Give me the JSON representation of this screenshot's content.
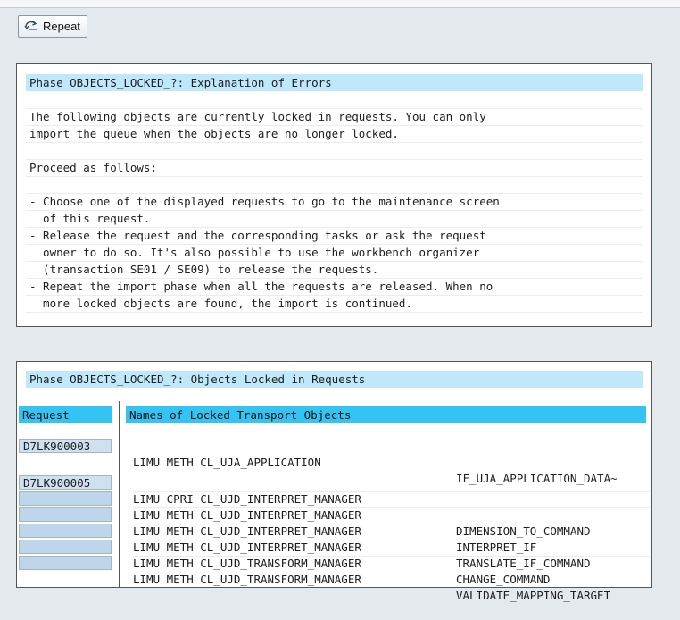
{
  "toolbar": {
    "repeat_label": "Repeat",
    "repeat_icon": "repeat-icon"
  },
  "explanation": {
    "title": "Phase OBJECTS_LOCKED_?: Explanation of Errors",
    "lines": [
      "",
      "The following objects are currently locked in requests. You can only",
      "import the queue when the objects are no longer locked.",
      "",
      "Proceed as follows:",
      "",
      "- Choose one of the displayed requests to go to the maintenance screen",
      "  of this request.",
      "- Release the request and the corresponding tasks or ask the request",
      "  owner to do so. It's also possible to use the workbench organizer",
      "  (transaction SE01 / SE09) to release the requests.",
      "- Repeat the import phase when all the requests are released. When no",
      "  more locked objects are found, the import is continued."
    ]
  },
  "objects_panel": {
    "title": "Phase OBJECTS_LOCKED_?: Objects Locked in Requests",
    "col_request": "Request",
    "col_names": "Names of Locked Transport Objects",
    "groups": [
      {
        "request": "D7LK900003",
        "rows": [
          {
            "object": "LIMU METH CL_UJA_APPLICATION",
            "sub": "IF_UJA_APPLICATION_DATA~"
          }
        ]
      },
      {
        "request": "D7LK900005",
        "rows": [
          {
            "object": "LIMU CPRI CL_UJD_INTERPRET_MANAGER",
            "sub": ""
          },
          {
            "object": "LIMU METH CL_UJD_INTERPRET_MANAGER",
            "sub": "DIMENSION_TO_COMMAND"
          },
          {
            "object": "LIMU METH CL_UJD_INTERPRET_MANAGER",
            "sub": "INTERPRET_IF"
          },
          {
            "object": "LIMU METH CL_UJD_INTERPRET_MANAGER",
            "sub": "TRANSLATE_IF_COMMAND"
          },
          {
            "object": "LIMU METH CL_UJD_TRANSFORM_MANAGER",
            "sub": "CHANGE_COMMAND"
          },
          {
            "object": "LIMU METH CL_UJD_TRANSFORM_MANAGER",
            "sub": "VALIDATE_MAPPING_TARGET"
          }
        ]
      }
    ]
  }
}
